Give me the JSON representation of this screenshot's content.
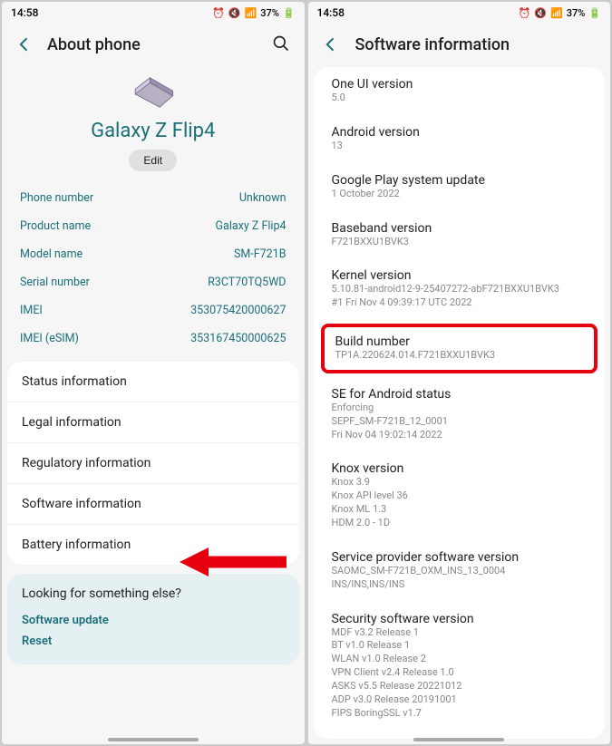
{
  "status": {
    "time": "14:58",
    "battery": "37%"
  },
  "left": {
    "title": "About phone",
    "device_name": "Galaxy Z Flip4",
    "edit_label": "Edit",
    "rows": [
      {
        "label": "Phone number",
        "value": "Unknown"
      },
      {
        "label": "Product name",
        "value": "Galaxy Z Flip4"
      },
      {
        "label": "Model name",
        "value": "SM-F721B"
      },
      {
        "label": "Serial number",
        "value": "R3CT70TQ5WD"
      },
      {
        "label": "IMEI",
        "value": "353075420000627"
      },
      {
        "label": "IMEI (eSIM)",
        "value": "353167450000625"
      }
    ],
    "card_items": [
      "Status information",
      "Legal information",
      "Regulatory information",
      "Software information",
      "Battery information"
    ],
    "tip_title": "Looking for something else?",
    "tip_links": [
      "Software update",
      "Reset"
    ]
  },
  "right": {
    "title": "Software information",
    "sections": [
      {
        "title": "One UI version",
        "sub": "5.0"
      },
      {
        "title": "Android version",
        "sub": "13"
      },
      {
        "title": "Google Play system update",
        "sub": "1 October 2022"
      },
      {
        "title": "Baseband version",
        "sub": "F721BXXU1BVK3"
      },
      {
        "title": "Kernel version",
        "sub": "5.10.81-android12-9-25407272-abF721BXXU1BVK3\n#1 Fri Nov 4 09:39:17 UTC 2022"
      }
    ],
    "build": {
      "title": "Build number",
      "sub": "TP1A.220624.014.F721BXXU1BVK3"
    },
    "after": [
      {
        "title": "SE for Android status",
        "sub": "Enforcing\nSEPF_SM-F721B_12_0001\nFri Nov 04 19:02:14 2022"
      },
      {
        "title": "Knox version",
        "sub": "Knox 3.9\nKnox API level 36\nKnox ML 1.3\nHDM 2.0 - 1D"
      },
      {
        "title": "Service provider software version",
        "sub": "SAOMC_SM-F721B_OXM_INS_13_0004\nINS/INS,INS/INS"
      },
      {
        "title": "Security software version",
        "sub": "MDF v3.2 Release 1\nBT v1.0 Release 1\nWLAN v1.0 Release 2\nVPN Client v2.4 Release 1.0\nASKS v5.5 Release 20221012\nADP v3.0 Release 20191001\nFIPS BoringSSL v1.7"
      }
    ]
  }
}
